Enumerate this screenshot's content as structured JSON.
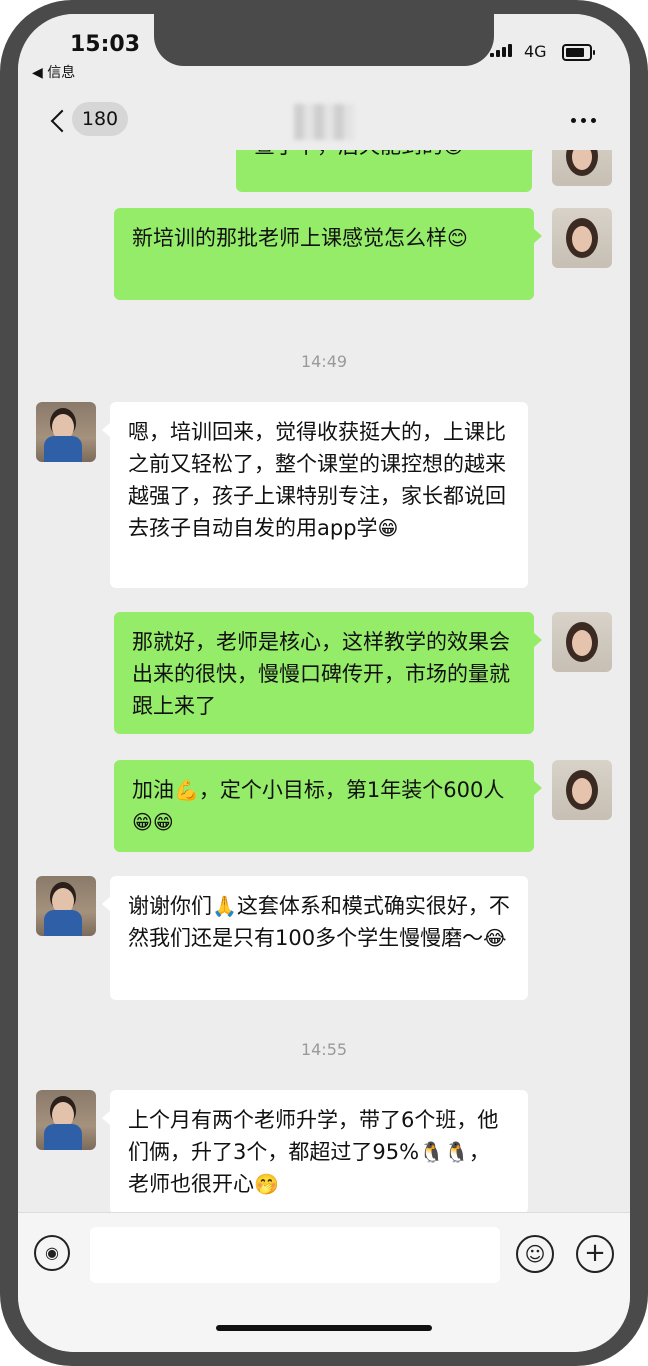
{
  "status_bar": {
    "time": "15:03",
    "back_app": "◀ 信息",
    "network": "4G"
  },
  "nav": {
    "unread_count": "180",
    "more_icon": "more-dots-icon"
  },
  "messages": [
    {
      "side": "out",
      "text": "查了下，后天能到的",
      "emoji": "😊"
    },
    {
      "side": "out",
      "text": "新培训的那批老师上课感觉怎么样",
      "emoji": "😊"
    },
    {
      "type": "timestamp",
      "text": "14:49"
    },
    {
      "side": "in",
      "text": "嗯，培训回来，觉得收获挺大的，上课比之前又轻松了，整个课堂的课控想的越来越强了，孩子上课特别专注，家长都说回去孩子自动自发的用app学",
      "emoji": "😁"
    },
    {
      "side": "out",
      "text": "那就好，老师是核心，这样教学的效果会出来的很快，慢慢口碑传开，市场的量就跟上来了",
      "emoji": ""
    },
    {
      "side": "out",
      "text_a": "加油",
      "emoji_a": "💪",
      "text_b": "，定个小目标，第1年装个600人",
      "emoji": "😁😁"
    },
    {
      "side": "in",
      "text_a": "谢谢你们",
      "emoji_a": "🙏",
      "text_b": "这套体系和模式确实很好，不然我们还是只有100多个学生慢慢磨～",
      "emoji": "😂"
    },
    {
      "type": "timestamp",
      "text": "14:55"
    },
    {
      "side": "in",
      "text_a": "上个月有两个老师升学，带了6个班，他们俩，升了3个，都超过了95%",
      "emoji_a": "🐧🐧",
      "text_b": "，老师也很开心",
      "emoji": "🤭"
    }
  ],
  "input_bar": {
    "voice_icon": "voice-icon",
    "emoji_icon": "emoji-icon",
    "plus_icon": "plus-icon"
  }
}
